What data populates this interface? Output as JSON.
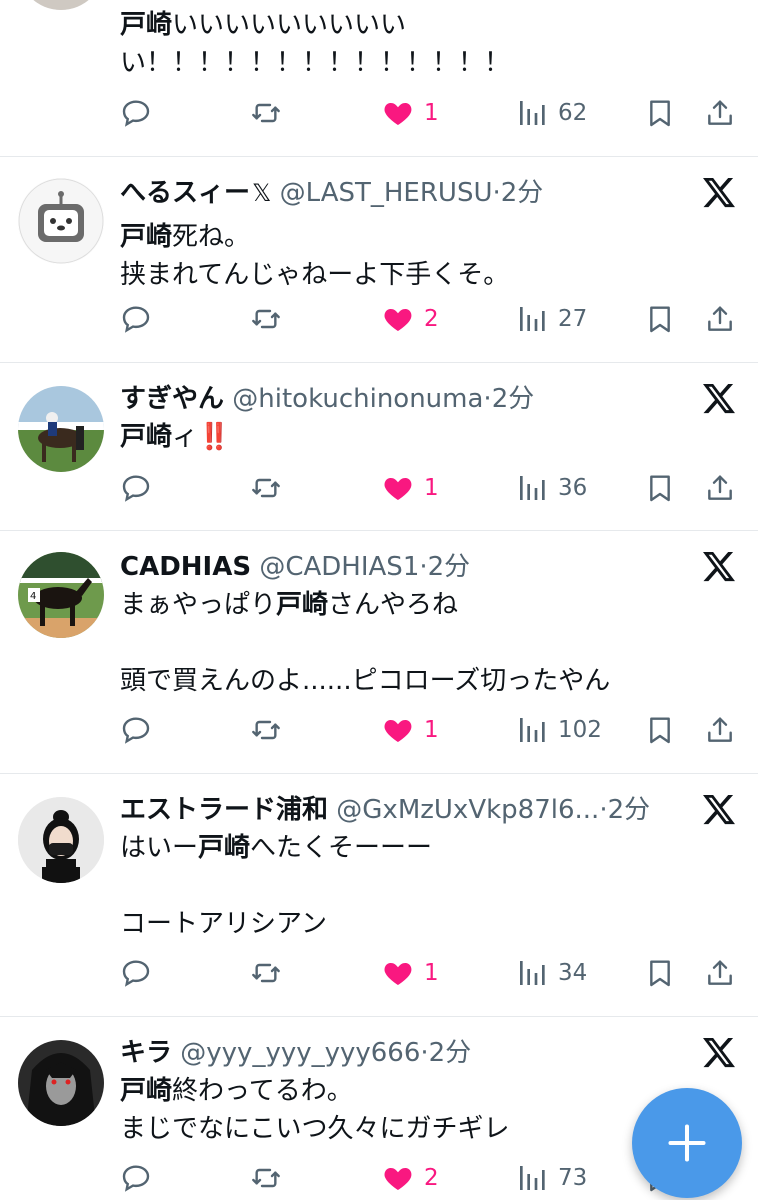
{
  "top_partial": {
    "text_line1_hl": "戸崎",
    "text_line1_rest": "いいいいいいいいい",
    "text_line2": "い！！！！！！！！！！！！！！",
    "likes": "1",
    "views": "62"
  },
  "tweets": [
    {
      "name": "へるスィー",
      "badge": "𝕏",
      "handle": "@LAST_HERUSU",
      "dot": "·",
      "time": "2分",
      "hl": "戸崎",
      "line1_rest": "死ね。",
      "line2": "挟まれてんじゃねーよ下手くそ。",
      "likes": "2",
      "views": "27"
    },
    {
      "name": "すぎやん",
      "handle": "@hitokuchinonuma",
      "dot": "·",
      "time": "2分",
      "hl": "戸崎",
      "line1_rest": "ィ",
      "emoji": "‼️",
      "likes": "1",
      "views": "36"
    },
    {
      "name": "CADHIAS",
      "handle": "@CADHIAS1",
      "dot": "·",
      "time": "2分",
      "line1_pre": "まぁやっぱり",
      "hl": "戸崎",
      "line1_post": "さんやろね",
      "line3": "頭で買えんのよ......ピコローズ切ったやん",
      "likes": "1",
      "views": "102"
    },
    {
      "name": "エストラード浦和",
      "handle": "@GxMzUxVkp87l6...",
      "dot": "·",
      "time": "2分",
      "line1_pre": "はいー",
      "hl": "戸崎",
      "line1_post": "へたくそーーー",
      "line3": "コートアリシアン",
      "likes": "1",
      "views": "34"
    },
    {
      "name": "キラ",
      "handle": "@yyy_yyy_yyy666",
      "dot": "·",
      "time": "2分",
      "hl": "戸崎",
      "line1_rest": "終わってるわ。",
      "line2": "まじでなにこいつ久々にガチギレ",
      "likes": "2",
      "views": "73"
    }
  ],
  "icons": {
    "reply": "reply-icon",
    "retweet": "retweet-icon",
    "like": "heart-icon",
    "views": "views-icon",
    "bookmark": "bookmark-icon",
    "share": "share-icon",
    "x": "x-logo-icon",
    "compose": "plus-icon"
  },
  "colors": {
    "like": "#f91880",
    "muted": "#536471",
    "fab": "#4a99e9",
    "text": "#0f1419"
  }
}
